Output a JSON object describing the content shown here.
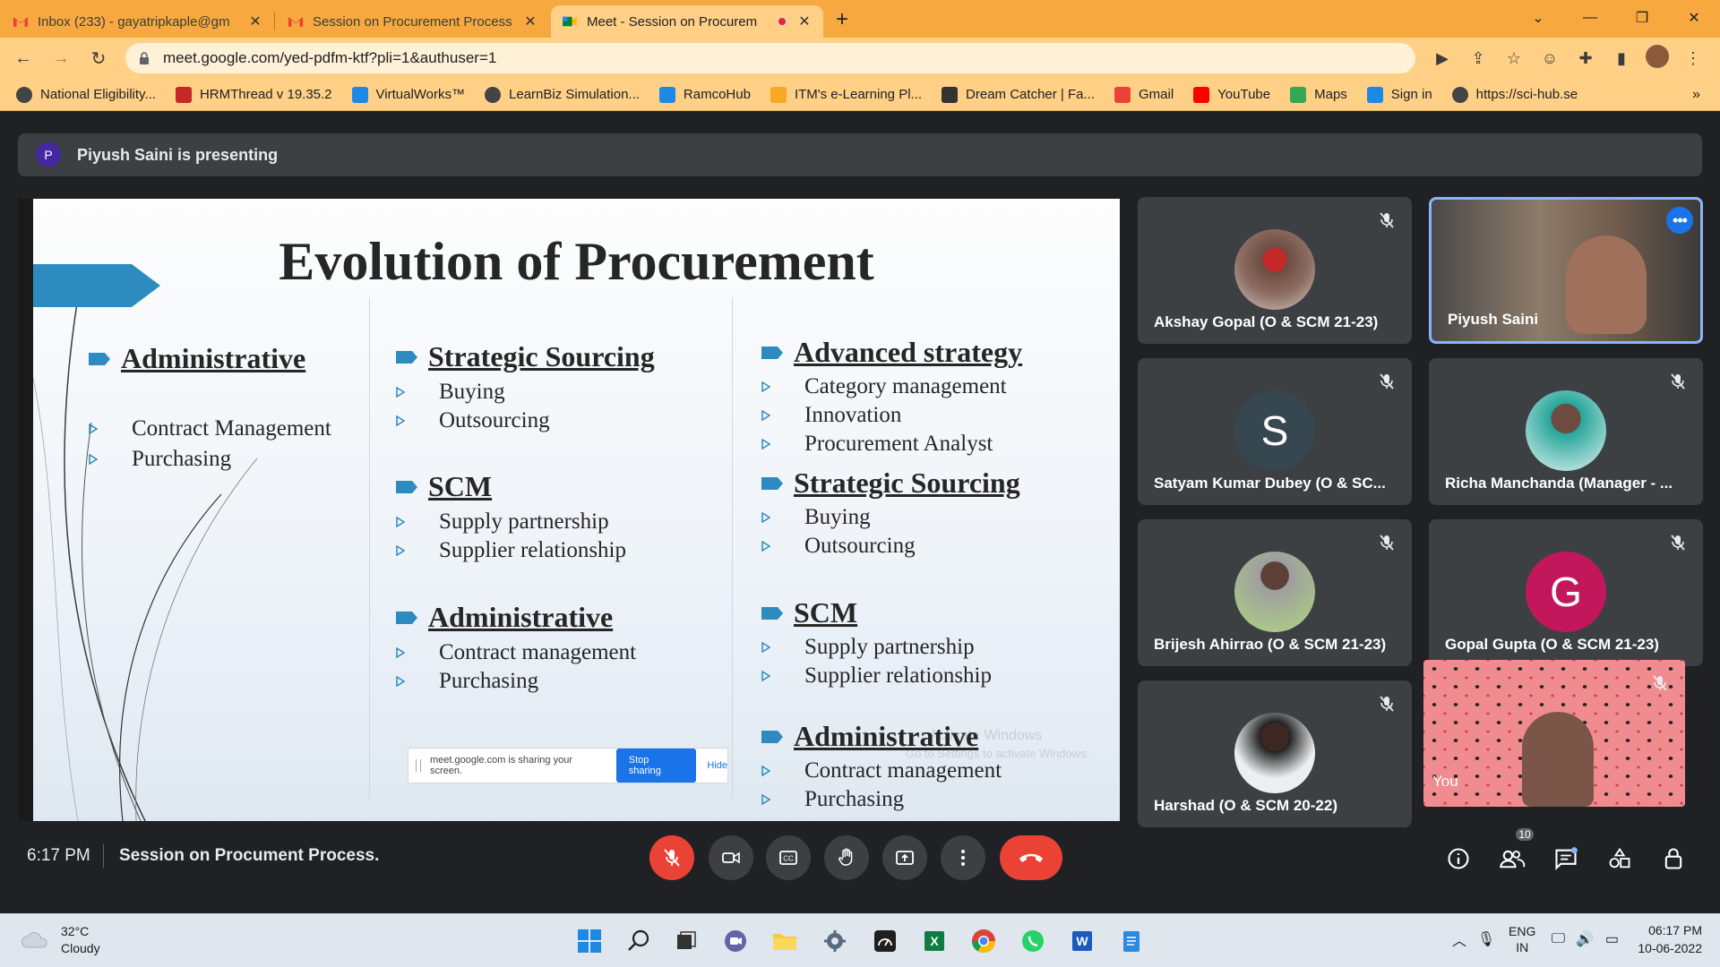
{
  "browser": {
    "tabs": [
      {
        "title": "Inbox (233) - gayatripkaple@gm",
        "active": false
      },
      {
        "title": "Session on Procurement Process",
        "active": false
      },
      {
        "title": "Meet - Session on Procurem",
        "active": true
      }
    ],
    "url": "meet.google.com/yed-pdfm-ktf?pli=1&authuser=1",
    "bookmarks": [
      {
        "label": "National Eligibility...",
        "color": "#444444"
      },
      {
        "label": "HRMThread v 19.35.2",
        "color": "#c62828"
      },
      {
        "label": "VirtualWorks™",
        "color": "#1e88e5"
      },
      {
        "label": "LearnBiz Simulation...",
        "color": "#444444"
      },
      {
        "label": "RamcoHub",
        "color": "#1e88e5"
      },
      {
        "label": "ITM's e-Learning Pl...",
        "color": "#f9a825"
      },
      {
        "label": "Dream Catcher | Fa...",
        "color": "#333333"
      },
      {
        "label": "Gmail",
        "color": "#ea4335"
      },
      {
        "label": "YouTube",
        "color": "#ff0000"
      },
      {
        "label": "Maps",
        "color": "#34a853"
      },
      {
        "label": "Sign in",
        "color": "#1e88e5"
      },
      {
        "label": "https://sci-hub.se",
        "color": "#444444"
      }
    ],
    "bookmarks_more": "»"
  },
  "meet": {
    "presenter_initial": "P",
    "presenting_text": "Piyush Saini is presenting",
    "time": "6:17 PM",
    "meeting_title": "Session on Procument Process.",
    "participant_count": "10",
    "participants": [
      {
        "name": "Akshay Gopal (O & SCM 21-23)"
      },
      {
        "name": "Piyush Saini"
      },
      {
        "name": "Satyam Kumar Dubey (O & SC...",
        "initial": "S"
      },
      {
        "name": "Richa Manchanda (Manager - ..."
      },
      {
        "name": "Brijesh Ahirrao (O & SCM 21-23)"
      },
      {
        "name": "Gopal Gupta (O & SCM 21-23)",
        "initial": "G"
      },
      {
        "name": "Harshad (O & SCM 20-22)"
      },
      {
        "name": "You"
      }
    ],
    "colors": {
      "red": "#ea4335",
      "blue": "#1a73e8",
      "tile": "#3c4043",
      "gopal": "#c2185b",
      "satyam": "#37474f"
    }
  },
  "slide": {
    "title": "Evolution of Procurement",
    "col1": {
      "heading": "Administrative",
      "items": [
        "Contract Management",
        "Purchasing"
      ]
    },
    "col2": [
      {
        "heading": "Strategic Sourcing",
        "items": [
          "Buying",
          "Outsourcing"
        ]
      },
      {
        "heading": "SCM",
        "items": [
          "Supply partnership",
          "Supplier relationship"
        ]
      },
      {
        "heading": "Administrative",
        "items": [
          "Contract management",
          "Purchasing"
        ]
      }
    ],
    "col3": [
      {
        "heading": "Advanced strategy",
        "items": [
          "Category management",
          "Innovation",
          "Procurement Analyst"
        ]
      },
      {
        "heading": "Strategic Sourcing",
        "items": [
          "Buying",
          "Outsourcing"
        ]
      },
      {
        "heading": "SCM",
        "items": [
          "Supply partnership",
          "Supplier relationship"
        ]
      },
      {
        "heading": "Administrative",
        "items": [
          "Contract management",
          "Purchasing"
        ]
      }
    ],
    "share_text": "meet.google.com is sharing your screen.",
    "stop_label": "Stop sharing",
    "hide_label": "Hide",
    "watermark_line1": "Activate Windows",
    "watermark_line2": "Go to Settings to activate Windows.",
    "accent": "#2e8bc0"
  },
  "taskbar": {
    "temp": "32°C",
    "condition": "Cloudy",
    "lang1": "ENG",
    "lang2": "IN",
    "time": "06:17 PM",
    "date": "10-06-2022"
  }
}
